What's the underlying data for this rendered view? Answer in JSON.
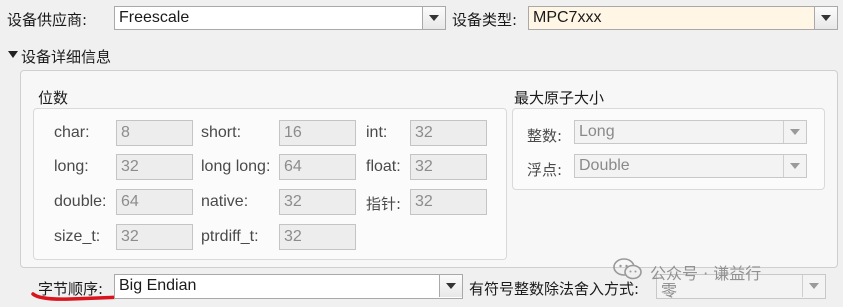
{
  "header": {
    "vendor_label": "设备供应商:",
    "vendor_value": "Freescale",
    "type_label": "设备类型:",
    "type_value": "MPC7xxx"
  },
  "details": {
    "toggle_label": "设备详细信息",
    "bits": {
      "title": "位数",
      "fields": {
        "char": {
          "label": "char:",
          "value": "8"
        },
        "short": {
          "label": "short:",
          "value": "16"
        },
        "int": {
          "label": "int:",
          "value": "32"
        },
        "long": {
          "label": "long:",
          "value": "32"
        },
        "long_long": {
          "label": "long long:",
          "value": "64"
        },
        "float": {
          "label": "float:",
          "value": "32"
        },
        "double": {
          "label": "double:",
          "value": "64"
        },
        "native": {
          "label": "native:",
          "value": "32"
        },
        "pointer": {
          "label": "指针:",
          "value": "32"
        },
        "size_t": {
          "label": "size_t:",
          "value": "32"
        },
        "ptrdiff_t": {
          "label": "ptrdiff_t:",
          "value": "32"
        }
      }
    },
    "atomic": {
      "title": "最大原子大小",
      "integer_label": "整数:",
      "integer_value": "Long",
      "float_label": "浮点:",
      "float_value": "Double"
    }
  },
  "bottom": {
    "byte_order_label": "字节顺序:",
    "byte_order_value": "Big Endian",
    "rounding_label": "有符号整数除法舍入方式:",
    "rounding_value": "零"
  },
  "watermark": {
    "text": "公众号 · 谦益行"
  },
  "colors": {
    "underline": "#d9141c"
  }
}
